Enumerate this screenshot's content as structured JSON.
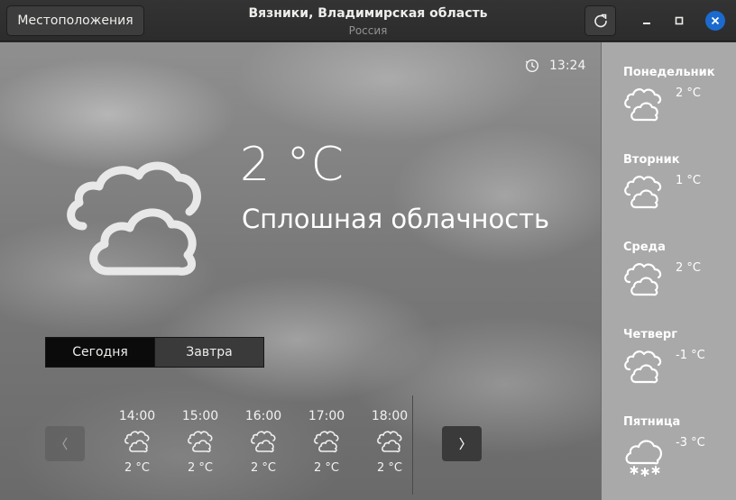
{
  "header": {
    "locations_label": "Местоположения",
    "title": "Вязники, Владимирская область",
    "subtitle": "Россия",
    "refresh_icon": "refresh-icon",
    "minimize_icon": "minimize-icon",
    "maximize_icon": "maximize-icon",
    "close_icon": "close-icon",
    "close_color": "#1b6ace"
  },
  "current": {
    "updated_time": "13:24",
    "temperature": "2 °C",
    "condition": "Сплошная облачность",
    "icon": "overcast-clouds-icon"
  },
  "tabs": [
    {
      "label": "Сегодня",
      "active": true
    },
    {
      "label": "Завтра",
      "active": false
    }
  ],
  "hourly": [
    {
      "time": "14:00",
      "temp": "2 °C",
      "icon": "overcast-clouds-icon"
    },
    {
      "time": "15:00",
      "temp": "2 °C",
      "icon": "overcast-clouds-icon"
    },
    {
      "time": "16:00",
      "temp": "2 °C",
      "icon": "overcast-clouds-icon"
    },
    {
      "time": "17:00",
      "temp": "2 °C",
      "icon": "overcast-clouds-icon"
    },
    {
      "time": "18:00",
      "temp": "2 °C",
      "icon": "overcast-clouds-icon"
    }
  ],
  "daily": [
    {
      "day": "Понедельник",
      "temp": "2 °C",
      "icon": "overcast-clouds-icon"
    },
    {
      "day": "Вторник",
      "temp": "1 °C",
      "icon": "overcast-clouds-icon"
    },
    {
      "day": "Среда",
      "temp": "2 °C",
      "icon": "overcast-clouds-icon"
    },
    {
      "day": "Четверг",
      "temp": "-1 °C",
      "icon": "overcast-clouds-icon"
    },
    {
      "day": "Пятница",
      "temp": "-3 °C",
      "icon": "snow-icon"
    }
  ]
}
